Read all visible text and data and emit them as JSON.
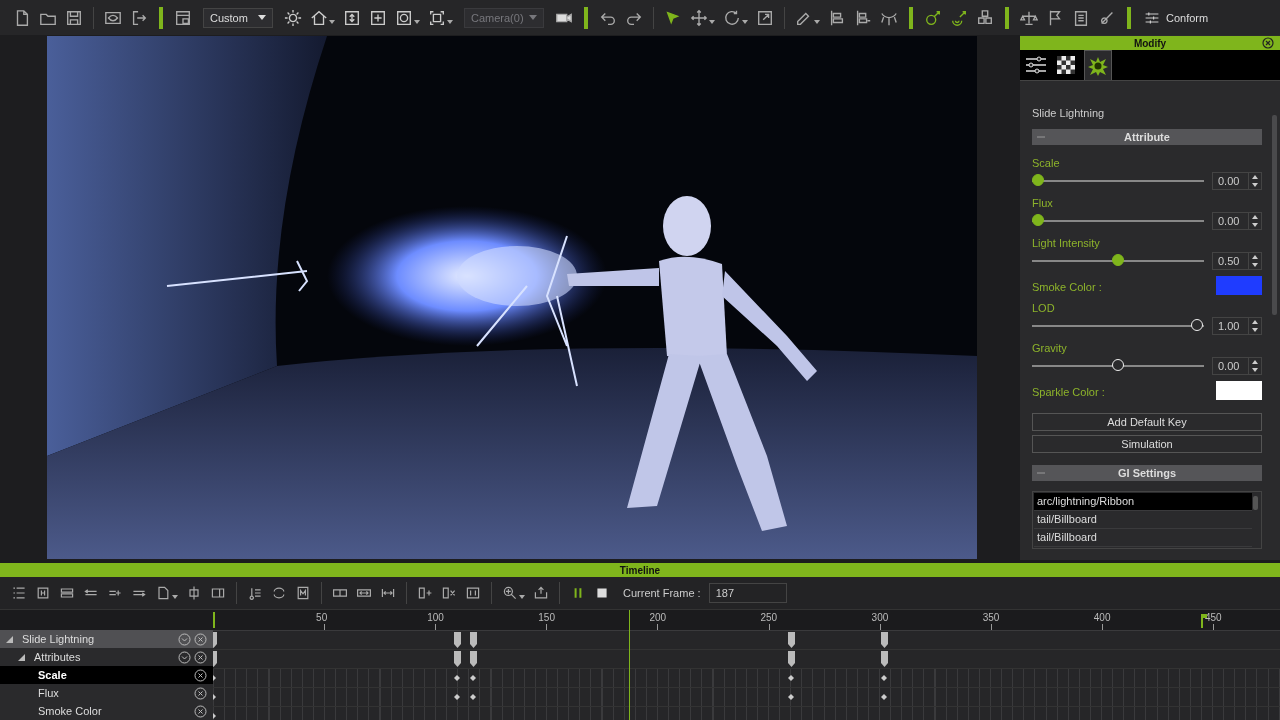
{
  "toolbar": {
    "view_select": {
      "value": "Custom"
    },
    "camera_select": {
      "value": "Camera(0)",
      "disabled": true
    },
    "conform_button": {
      "label": "Conform"
    }
  },
  "modify_panel": {
    "title": "Modify",
    "tabs": [
      {
        "kind": "sliders",
        "selected": false
      },
      {
        "kind": "checker",
        "selected": false
      },
      {
        "kind": "particle",
        "selected": true
      }
    ],
    "object_name": "Slide Lightning",
    "attribute_section": {
      "title": "Attribute",
      "expanded": true
    },
    "params": [
      {
        "kind": "slider",
        "label": "Scale",
        "level": 0,
        "value": "0.00",
        "highlighted": true
      },
      {
        "kind": "slider",
        "label": "Flux",
        "level": 0,
        "value": "0.00",
        "highlighted": true
      },
      {
        "kind": "slider",
        "label": "Light Intensity",
        "level": 0.5,
        "value": "0.50",
        "highlighted": true
      },
      {
        "kind": "color",
        "label": "Smoke Color :",
        "color": "#1f3cff"
      },
      {
        "kind": "slider",
        "label": "LOD",
        "level": 1,
        "value": "1.00",
        "highlighted": false
      },
      {
        "kind": "slider",
        "label": "Gravity",
        "level": 0.5,
        "value": "0.00",
        "highlighted": false
      },
      {
        "kind": "color",
        "label": "Sparkle Color :",
        "color": "#ffffff"
      }
    ],
    "buttons": [
      "Add Default Key",
      "Simulation"
    ],
    "gi_section": {
      "title": "GI Settings",
      "expanded": true
    },
    "gi_list": [
      {
        "label": "arc/lightning/Ribbon",
        "selected": true
      },
      {
        "label": "tail/Billboard",
        "selected": false
      },
      {
        "label": "tail/Billboard",
        "selected": false
      }
    ]
  },
  "timeline": {
    "title": "Timeline",
    "current_frame_label": "Current Frame :",
    "current_frame": "187",
    "ruler_ticks": [
      "50",
      "100",
      "150",
      "200",
      "250",
      "300",
      "350",
      "400",
      "450"
    ],
    "tracks": [
      {
        "label": "Slide Lightning",
        "expanded": true,
        "children": [
          {
            "label": "Attributes",
            "expanded": true,
            "children": [
              {
                "label": "Scale",
                "selected": true
              },
              {
                "label": "Flux",
                "selected": false
              },
              {
                "label": "Smoke Color",
                "selected": false
              }
            ]
          }
        ]
      }
    ]
  }
}
